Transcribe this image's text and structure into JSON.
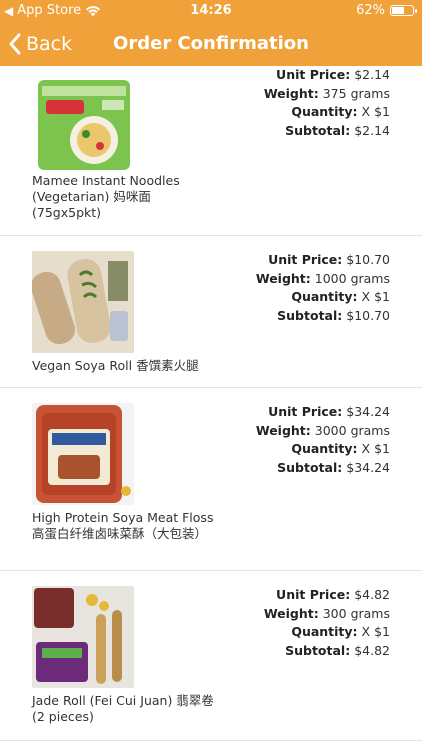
{
  "status_bar": {
    "back_app": "App Store",
    "time": "14:26",
    "battery": "62%",
    "battery_level": 0.62
  },
  "nav": {
    "back_label": "Back",
    "title": "Order Confirmation"
  },
  "labels": {
    "unit_price": "Unit Price:",
    "weight": "Weight:",
    "quantity": "Quantity:",
    "subtotal": "Subtotal:"
  },
  "items": [
    {
      "name": "Mamee Instant Noodles (Vegetarian) 妈咪面 (75gx5pkt)",
      "unit_price": "$2.14",
      "weight": "375 grams",
      "quantity": "X $1",
      "subtotal": "$2.14",
      "image_icon": "noodle-pack-image",
      "colors": {
        "bg": "#78c24b",
        "accent": "#e0383c"
      }
    },
    {
      "name": "Vegan Soya Roll 香馔素火腿",
      "unit_price": "$10.70",
      "weight": "1000 grams",
      "quantity": "X $1",
      "subtotal": "$10.70",
      "image_icon": "soya-roll-image",
      "colors": {
        "bg": "#d9cbb5",
        "accent": "#6b8a3a"
      }
    },
    {
      "name": "High Protein Soya Meat Floss 高蛋白纤维卤味菜酥（大包装）",
      "unit_price": "$34.24",
      "weight": "3000 grams",
      "quantity": "X $1",
      "subtotal": "$34.24",
      "image_icon": "meat-floss-jar-image",
      "colors": {
        "bg": "#c9553a",
        "accent": "#f3e9d2"
      }
    },
    {
      "name": "Jade Roll (Fei Cui Juan) 翡翠卷 (2 pieces)",
      "unit_price": "$4.82",
      "weight": "300 grams",
      "quantity": "X $1",
      "subtotal": "$4.82",
      "image_icon": "jade-roll-image",
      "colors": {
        "bg": "#c7a15a",
        "accent": "#5a7a3a"
      }
    }
  ]
}
